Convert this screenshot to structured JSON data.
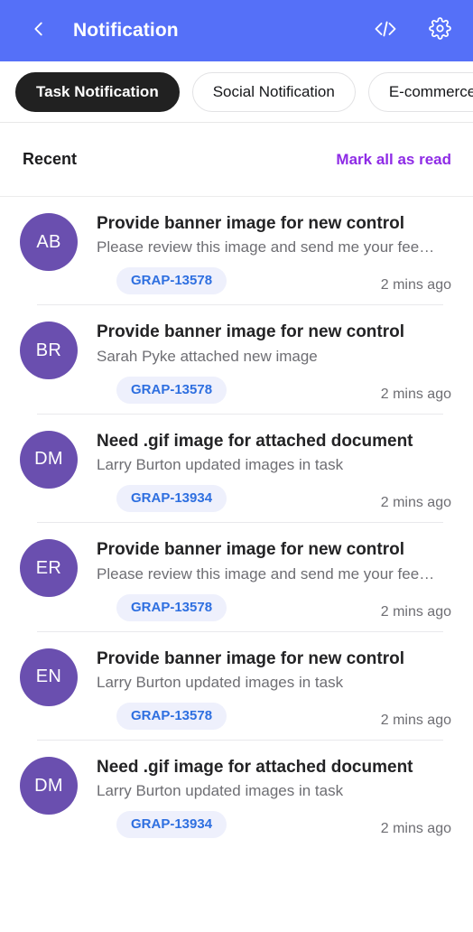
{
  "header": {
    "title": "Notification",
    "back_icon": "chevron-left-icon",
    "actions": [
      {
        "icon": "code-icon",
        "name": "code-button"
      },
      {
        "icon": "gear-icon",
        "name": "settings-button"
      }
    ],
    "background_color": "#5570F8"
  },
  "tabs": [
    {
      "label": "Task Notification",
      "active": true
    },
    {
      "label": "Social Notification",
      "active": false
    },
    {
      "label": "E-commerce",
      "active": false
    }
  ],
  "section": {
    "title": "Recent",
    "mark_all_label": "Mark all as read",
    "mark_all_color": "#8E2BE6"
  },
  "notifications": [
    {
      "initials": "AB",
      "title": "Provide banner image for new control",
      "subtitle": "Please review this image and send me your fee…",
      "tag": "GRAP-13578",
      "time": "2 mins ago"
    },
    {
      "initials": "BR",
      "title": "Provide banner image for new control",
      "subtitle": "Sarah Pyke attached new image",
      "tag": "GRAP-13578",
      "time": "2 mins ago"
    },
    {
      "initials": "DM",
      "title": "Need .gif image for attached document",
      "subtitle": "Larry Burton updated images in task",
      "tag": "GRAP-13934",
      "time": "2 mins ago"
    },
    {
      "initials": "ER",
      "title": "Provide banner image for new control",
      "subtitle": "Please review this image and send me your fee…",
      "tag": "GRAP-13578",
      "time": "2 mins ago"
    },
    {
      "initials": "EN",
      "title": "Provide banner image for new control",
      "subtitle": "Larry Burton updated images in task",
      "tag": "GRAP-13578",
      "time": "2 mins ago"
    },
    {
      "initials": "DM",
      "title": "Need .gif image for attached document",
      "subtitle": "Larry Burton updated images in task",
      "tag": "GRAP-13934",
      "time": "2 mins ago"
    }
  ],
  "theme": {
    "avatar_color": "#6A4FAF",
    "tag_bg": "#EEF0FC",
    "tag_text": "#2E6FE0",
    "active_tab_bg": "#212121"
  }
}
